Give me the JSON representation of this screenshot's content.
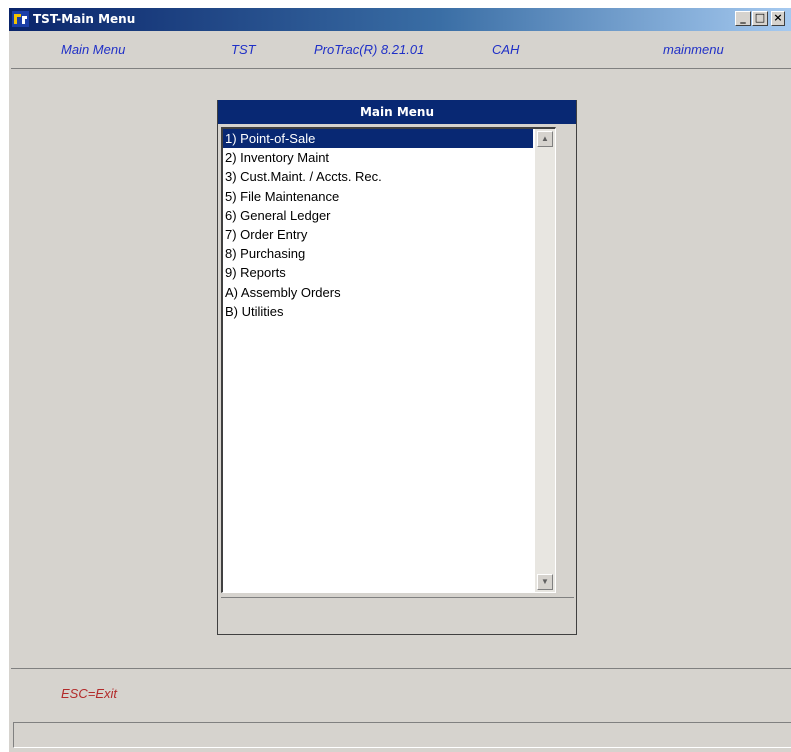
{
  "window": {
    "title": "TST-Main Menu",
    "controls": {
      "minimize": "_",
      "maximize": "□",
      "close": "×"
    }
  },
  "infobar": {
    "screen": "Main Menu",
    "company": "TST",
    "version": "ProTrac(R) 8.21.01",
    "user": "CAH",
    "program": "mainmenu"
  },
  "menu": {
    "title": "Main Menu",
    "items": [
      "1) Point-of-Sale",
      "2) Inventory Maint",
      "3) Cust.Maint. / Accts. Rec.",
      "5) File Maintenance",
      "6) General Ledger",
      "7) Order Entry",
      "8) Purchasing",
      "9) Reports",
      "A) Assembly Orders",
      "B) Utilities"
    ],
    "selected_index": 0
  },
  "footer": {
    "hint": "ESC=Exit",
    "status": ""
  },
  "colors": {
    "title_gradient_start": "#0a246a",
    "menu_header": "#082873",
    "info_text": "#1f2fc7",
    "hint_text": "#b22a2a",
    "window_bg": "#d6d3ce"
  }
}
